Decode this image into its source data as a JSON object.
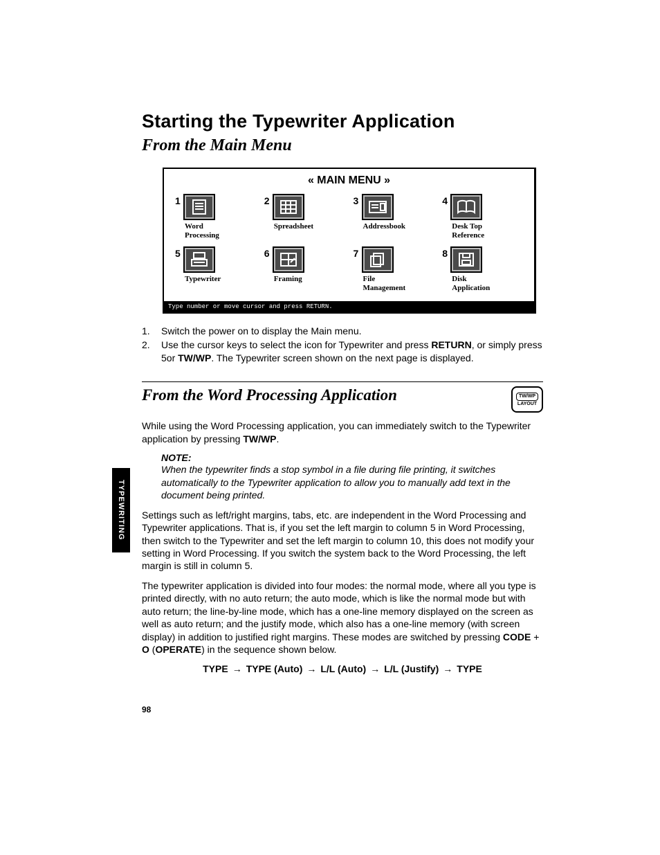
{
  "title": "Starting the Typewriter Application",
  "subtitle": "From the Main Menu",
  "menu": {
    "header": "« MAIN MENU »",
    "items": [
      {
        "num": "1",
        "label": "Word\nProcessing",
        "icon": "doc-lines"
      },
      {
        "num": "2",
        "label": "Spreadsheet",
        "icon": "grid"
      },
      {
        "num": "3",
        "label": "Addressbook",
        "icon": "card"
      },
      {
        "num": "4",
        "label": "Desk Top\nReference",
        "icon": "book"
      },
      {
        "num": "5",
        "label": "Typewriter",
        "icon": "typewriter"
      },
      {
        "num": "6",
        "label": "Framing",
        "icon": "frame"
      },
      {
        "num": "7",
        "label": "File\nManagement",
        "icon": "files"
      },
      {
        "num": "8",
        "label": "Disk\nApplication",
        "icon": "disk"
      }
    ],
    "footer": "Type number or move cursor and press RETURN."
  },
  "steps": [
    {
      "n": "1.",
      "text": "Switch the power on to display the Main menu."
    },
    {
      "n": "2.",
      "text_html": "Use the cursor keys to select the icon for Typewriter and press <b>RETURN</b>, or simply press 5or <b>TW/WP</b>. The Typewriter screen shown on the next page is displayed."
    }
  ],
  "section2": {
    "title": "From the Word Processing Application",
    "key": {
      "top": "TW/WP",
      "bottom": "LAYOUT"
    }
  },
  "para_intro_html": "While using the Word Processing application, you can immediately switch to the Typewriter application by pressing <b>TW/WP</b>.",
  "note": {
    "head": "NOTE:",
    "body": "When the typewriter finds a stop symbol in a file during file printing, it switches automatically to the Typewriter application to allow you to manually add text in the document being printed."
  },
  "para_settings": "Settings such as left/right margins, tabs, etc. are independent in the Word Processing and Typewriter applications. That is, if you set the left margin to column 5 in Word Processing, then switch to the Typewriter and set the left margin to column 10, this does not modify your setting in Word Processing. If you switch the system back to the Word Processing, the left margin is still in column 5.",
  "para_modes_html": "The typewriter application is divided into four modes: the normal mode, where all you type is printed directly, with no auto return; the auto mode, which is like the normal mode but with auto return; the line-by-line mode, which has a one-line memory displayed on the screen as well as auto return; and the justify mode, which also has a one-line memory (with screen display) in addition to justified right margins. These modes are switched by pressing <b>CODE</b> + <b>O</b> (<b>OPERATE</b>) in the sequence shown below.",
  "mode_sequence": [
    "TYPE",
    "TYPE (Auto)",
    "L/L (Auto)",
    "L/L (Justify)",
    "TYPE"
  ],
  "arrow": "→",
  "side_tab": "TYPEWRITING",
  "page_number": "98"
}
